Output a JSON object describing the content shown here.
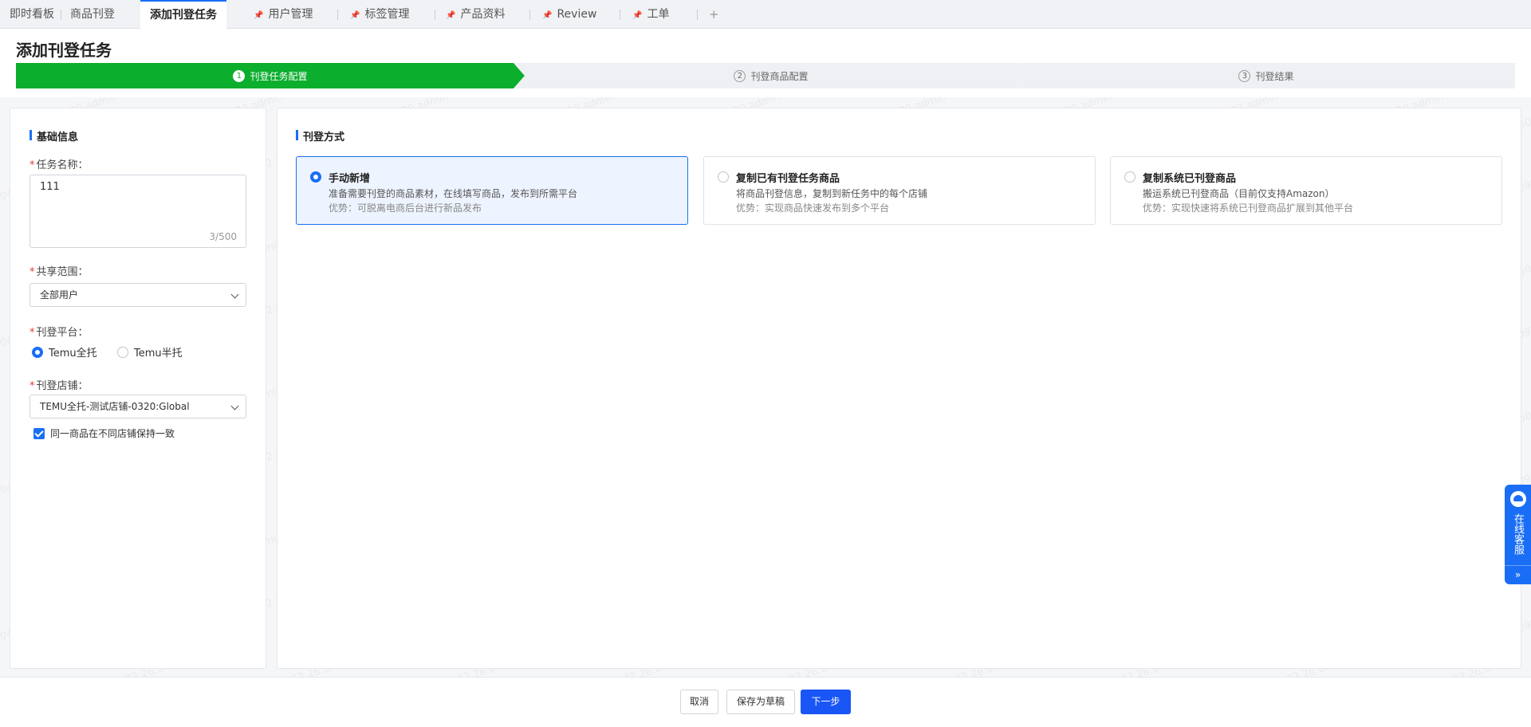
{
  "tabs": [
    {
      "label": "即时看板",
      "pinned": false,
      "active": false
    },
    {
      "label": "商品刊登",
      "pinned": false,
      "active": false
    },
    {
      "label": "添加刊登任务",
      "pinned": false,
      "active": true
    },
    {
      "label": "用户管理",
      "pinned": true,
      "active": false
    },
    {
      "label": "标签管理",
      "pinned": true,
      "active": false
    },
    {
      "label": "产品资料",
      "pinned": true,
      "active": false
    },
    {
      "label": "Review",
      "pinned": true,
      "active": false
    },
    {
      "label": "工单",
      "pinned": true,
      "active": false
    }
  ],
  "tab_add": "+",
  "page_title": "添加刊登任务",
  "steps": [
    {
      "num": "1",
      "label": "刊登任务配置",
      "status": "active"
    },
    {
      "num": "2",
      "label": "刊登商品配置",
      "status": "pending"
    },
    {
      "num": "3",
      "label": "刊登结果",
      "status": "pending"
    }
  ],
  "basic": {
    "title": "基础信息",
    "required_mark": "*",
    "task_name_label": "任务名称：",
    "task_name_value": "111",
    "task_name_counter": "3/500",
    "share_label": "共享范围：",
    "share_value": "全部用户",
    "platform_label": "刊登平台：",
    "platform_options": [
      {
        "label": "Temu全托",
        "selected": true
      },
      {
        "label": "Temu半托",
        "selected": false
      }
    ],
    "store_label": "刊登店铺：",
    "store_value": "TEMU全托-测试店铺-0320:Global",
    "checkbox_label": "同一商品在不同店铺保持一致",
    "checkbox_checked": true
  },
  "method": {
    "title": "刊登方式",
    "options": [
      {
        "title": "手动新增",
        "desc": "准备需要刊登的商品素材，在线填写商品，发布到所需平台",
        "adv": "优势：可脱离电商后台进行新品发布",
        "selected": true
      },
      {
        "title": "复制已有刊登任务商品",
        "desc": "将商品刊登信息，复制到新任务中的每个店铺",
        "adv": "优势：实现商品快速发布到多个平台",
        "selected": false
      },
      {
        "title": "复制系统已刊登商品",
        "desc": "搬运系统已刊登商品（目前仅支持Amazon）",
        "adv": "优势：实现快速将系统已刊登商品扩展到其他平台",
        "selected": false
      }
    ]
  },
  "footer": {
    "cancel": "取消",
    "save_draft": "保存为草稿",
    "next": "下一步"
  },
  "chat": {
    "label": "在线客服",
    "collapse": "»"
  },
  "watermark_text": "2504010920 admin 172.26.0.1",
  "colors": {
    "accent": "#1a6ef5",
    "step_active": "#0cae2e",
    "primary_button": "#1a55f5",
    "required": "#e53935"
  }
}
